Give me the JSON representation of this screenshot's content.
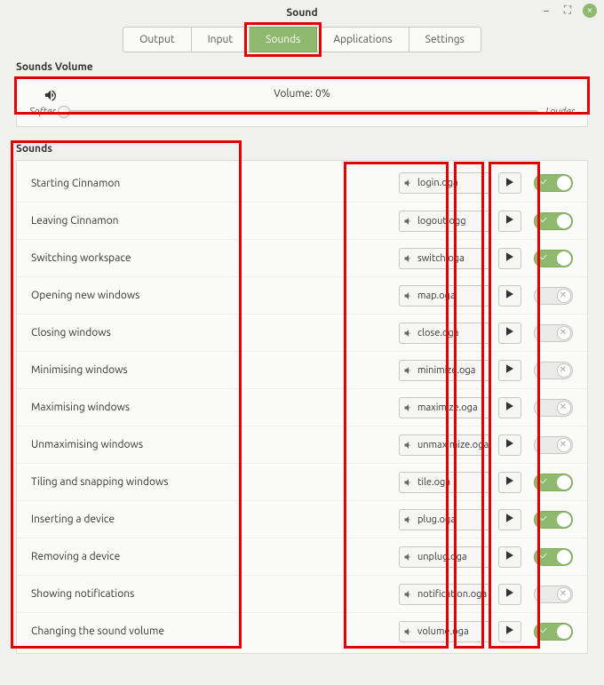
{
  "window": {
    "title": "Sound"
  },
  "tabs": {
    "output": "Output",
    "input": "Input",
    "sounds": "Sounds",
    "applications": "Applications",
    "settings": "Settings",
    "active": "sounds"
  },
  "volume_section": {
    "heading": "Sounds Volume",
    "label": "Volume: 0%",
    "softer": "Softer",
    "louder": "Louder",
    "value_percent": 0
  },
  "sounds_section": {
    "heading": "Sounds",
    "rows": [
      {
        "name": "Starting Cinnamon",
        "file": "login.oga",
        "enabled": true
      },
      {
        "name": "Leaving Cinnamon",
        "file": "logout.ogg",
        "enabled": true
      },
      {
        "name": "Switching workspace",
        "file": "switch.oga",
        "enabled": true
      },
      {
        "name": "Opening new windows",
        "file": "map.oga",
        "enabled": false
      },
      {
        "name": "Closing windows",
        "file": "close.oga",
        "enabled": false
      },
      {
        "name": "Minimising windows",
        "file": "minimize.oga",
        "enabled": false
      },
      {
        "name": "Maximising windows",
        "file": "maximize.oga",
        "enabled": false
      },
      {
        "name": "Unmaximising windows",
        "file": "unmaximize.oga",
        "enabled": false
      },
      {
        "name": "Tiling and snapping windows",
        "file": "tile.oga",
        "enabled": true
      },
      {
        "name": "Inserting a device",
        "file": "plug.oga",
        "enabled": true
      },
      {
        "name": "Removing a device",
        "file": "unplug.oga",
        "enabled": true
      },
      {
        "name": "Showing notifications",
        "file": "notification.oga",
        "enabled": false
      },
      {
        "name": "Changing the sound volume",
        "file": "volume.oga",
        "enabled": true
      }
    ]
  }
}
